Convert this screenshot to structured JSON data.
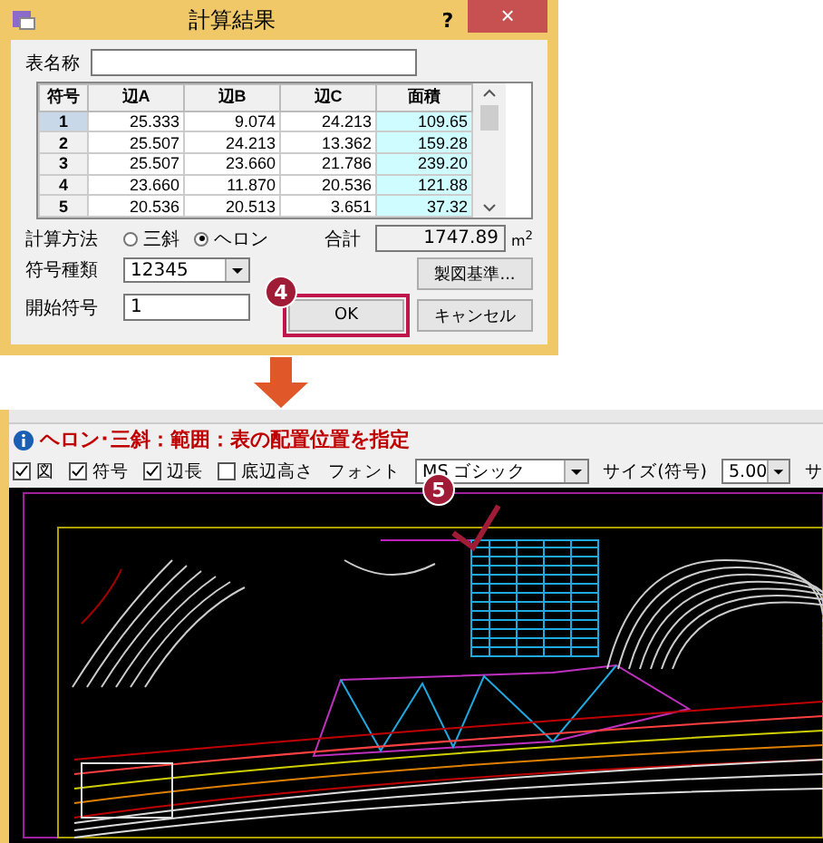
{
  "dialog": {
    "title": "計算結果",
    "help": "?",
    "close": "×",
    "table_name_label": "表名称",
    "table": {
      "columns": [
        "符号",
        "辺A",
        "辺B",
        "辺C",
        "面積"
      ],
      "rows": [
        {
          "cells": [
            "1",
            "25.333",
            "9.074",
            "24.213",
            "109.65"
          ],
          "selected": true
        },
        {
          "cells": [
            "2",
            "25.507",
            "24.213",
            "13.362",
            "159.28"
          ],
          "selected": false
        },
        {
          "cells": [
            "3",
            "25.507",
            "23.660",
            "21.786",
            "239.20"
          ],
          "selected": false
        },
        {
          "cells": [
            "4",
            "23.660",
            "11.870",
            "20.536",
            "121.88"
          ],
          "selected": false
        },
        {
          "cells": [
            "5",
            "20.536",
            "20.513",
            "3.651",
            "37.32"
          ],
          "selected": false
        }
      ]
    },
    "calc_method_label": "計算方法",
    "calc_methods": [
      {
        "label": "三斜",
        "selected": false
      },
      {
        "label": "ヘロン",
        "selected": true
      }
    ],
    "total_label": "合計",
    "total_value": "1747.89",
    "total_unit": "m$^{2}$",
    "symbol_type_label": "符号種類",
    "symbol_type_value": "12345",
    "start_symbol_label": "開始符号",
    "start_symbol_value": "1",
    "drafting_button": "製図基準...",
    "ok_button": "OK",
    "cancel_button": "キャンセル",
    "callout": "4"
  },
  "cad": {
    "message": "ヘロン･三斜：範囲：表の配置位置を指定",
    "options": [
      {
        "label": "図",
        "checked": true
      },
      {
        "label": "符号",
        "checked": true
      },
      {
        "label": "辺長",
        "checked": true
      },
      {
        "label": "底辺高さ",
        "checked": false
      }
    ],
    "font_label": "フォント",
    "font_value": "MS ゴシック",
    "size_label": "サイズ(符号)",
    "size_value": "5.00",
    "cut_label": "サ",
    "callout": "5"
  }
}
